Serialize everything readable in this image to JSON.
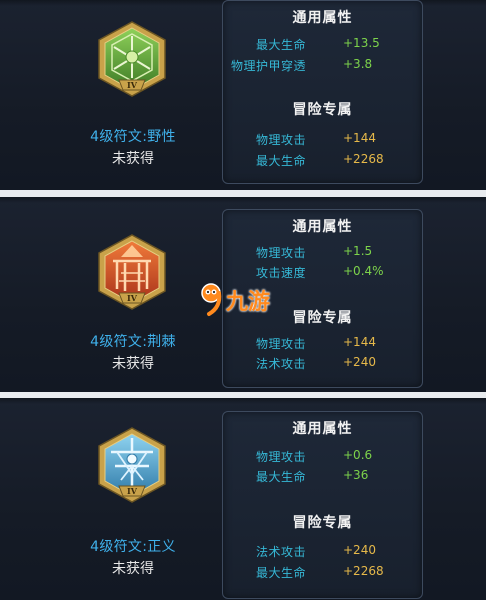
{
  "runes": [
    {
      "name": "4级符文:野性",
      "status": "未获得",
      "icon": "green-hexagon-rune-icon",
      "level_numeral": "IV",
      "general_title": "通用属性",
      "general_stats": [
        {
          "name": "最大生命",
          "value": "+13.5"
        },
        {
          "name": "物理护甲穿透",
          "value": "+3.8"
        }
      ],
      "adventure_title": "冒险专属",
      "adventure_stats": [
        {
          "name": "物理攻击",
          "value": "+144"
        },
        {
          "name": "最大生命",
          "value": "+2268"
        }
      ]
    },
    {
      "name": "4级符文:荆棘",
      "status": "未获得",
      "icon": "red-hexagon-rune-icon",
      "level_numeral": "IV",
      "general_title": "通用属性",
      "general_stats": [
        {
          "name": "物理攻击",
          "value": "+1.5"
        },
        {
          "name": "攻击速度",
          "value": "+0.4%"
        }
      ],
      "adventure_title": "冒险专属",
      "adventure_stats": [
        {
          "name": "物理攻击",
          "value": "+144"
        },
        {
          "name": "法术攻击",
          "value": "+240"
        }
      ]
    },
    {
      "name": "4级符文:正义",
      "status": "未获得",
      "icon": "blue-hexagon-rune-icon",
      "level_numeral": "IV",
      "general_title": "通用属性",
      "general_stats": [
        {
          "name": "物理攻击",
          "value": "+0.6"
        },
        {
          "name": "最大生命",
          "value": "+36"
        }
      ],
      "adventure_title": "冒险专属",
      "adventure_stats": [
        {
          "name": "法术攻击",
          "value": "+240"
        },
        {
          "name": "最大生命",
          "value": "+2268"
        }
      ]
    }
  ],
  "watermark": {
    "text": "九游",
    "icon": "nine-game-logo-icon"
  },
  "colors": {
    "rune_name": "#3fb0ea",
    "stat_name": "#36b8d6",
    "general_value": "#7dd34b",
    "adventure_value": "#e6b94a",
    "green_rune": "#5aa83a",
    "red_rune": "#d2502a",
    "blue_rune": "#4a9ec8",
    "gold_frame": "#c9a24a"
  }
}
